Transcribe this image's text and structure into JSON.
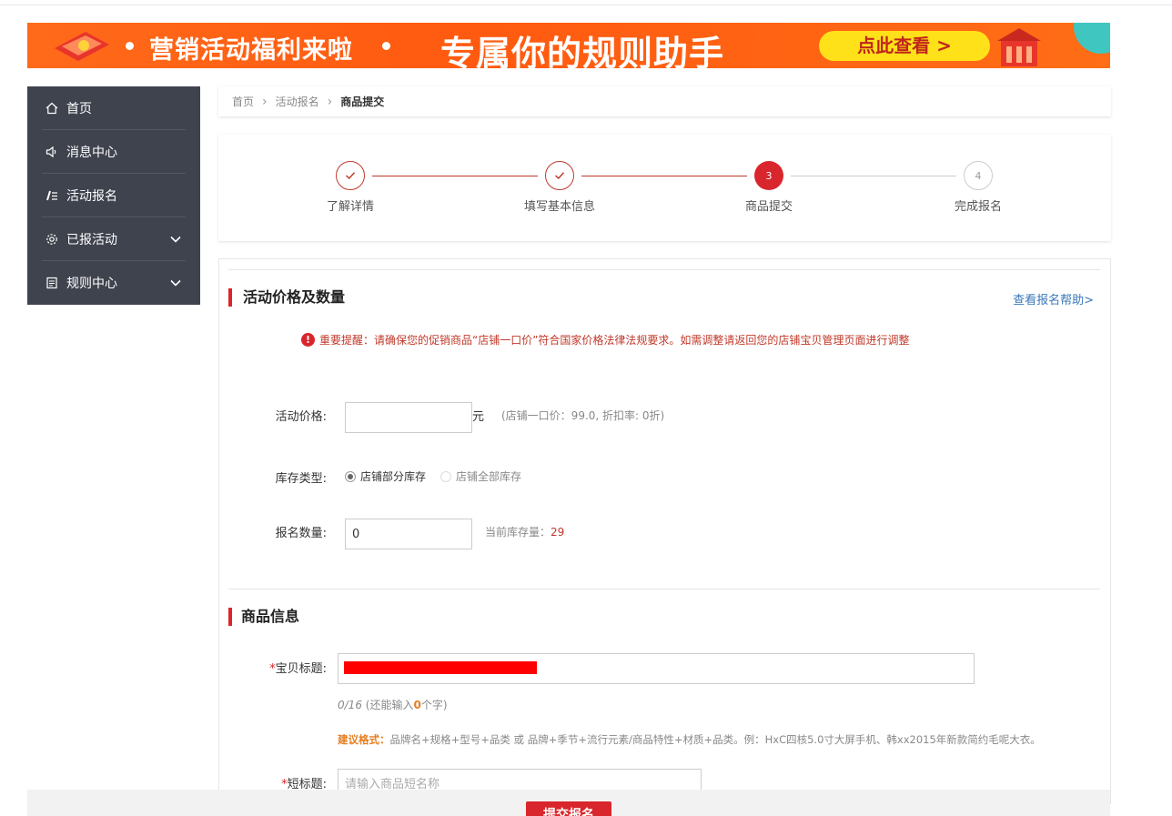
{
  "banner": {
    "text1": "营销活动福利来啦",
    "text2": "专属你的规则助手",
    "cta": "点此查看 >",
    "colors": {
      "bg": "#ff5a10",
      "cta_bg": "#ffe11a",
      "cta_text": "#c0261a"
    }
  },
  "sidebar": {
    "items": [
      {
        "label": "首页",
        "icon": "home-icon",
        "expandable": false
      },
      {
        "label": "消息中心",
        "icon": "speaker-icon",
        "expandable": false
      },
      {
        "label": "活动报名",
        "icon": "edit-list-icon",
        "expandable": false
      },
      {
        "label": "已报活动",
        "icon": "gear-icon",
        "expandable": true
      },
      {
        "label": "规则中心",
        "icon": "document-icon",
        "expandable": true
      }
    ]
  },
  "breadcrumb": {
    "items": [
      "首页",
      "活动报名",
      "商品提交"
    ]
  },
  "steps": {
    "items": [
      {
        "label": "了解详情",
        "state": "done",
        "mark": "check-icon"
      },
      {
        "label": "填写基本信息",
        "state": "done",
        "mark": "check-icon"
      },
      {
        "label": "商品提交",
        "state": "active",
        "number": "3"
      },
      {
        "label": "完成报名",
        "state": "todo",
        "number": "4"
      }
    ]
  },
  "price_section": {
    "title": "活动价格及数量",
    "help_link": "查看报名帮助>",
    "notice": "重要提醒：请确保您的促销商品“店铺一口价”符合国家价格法律法规要求。如需调整请返回您的店铺宝贝管理页面进行调整",
    "price_label": "活动价格:",
    "price_value": "",
    "price_unit": "元",
    "price_hint": "(店铺一口价：99.0, 折扣率: 0折)",
    "stock_type_label": "库存类型:",
    "stock_options": [
      {
        "label": "店铺部分库存",
        "selected": true
      },
      {
        "label": "店铺全部库存",
        "selected": false
      }
    ],
    "quantity_label": "报名数量:",
    "quantity_value": "0",
    "stock_hint_label": "当前库存量：",
    "stock_hint_value": "29"
  },
  "product_section": {
    "title": "商品信息",
    "title_label": "宝贝标题:",
    "counter_text": "0/16",
    "counter_prefix": "(还能输入",
    "counter_remaining": "0",
    "counter_suffix": "个字)",
    "format_label": "建议格式：",
    "format_text": "品牌名+规格+型号+品类 或 品牌+季节+流行元素/商品特性+材质+品类。例：HxC四核5.0寸大屏手机、韩xx2015年新款简约毛呢大衣。",
    "short_title_label": "短标题:",
    "short_title_placeholder": "请输入商品短名称",
    "required_mark": "*"
  },
  "footer": {
    "submit_label": "提交报名"
  },
  "colors": {
    "accent": "#d9262c",
    "link": "#3a78b8",
    "sidebar_bg": "#3f434e"
  }
}
